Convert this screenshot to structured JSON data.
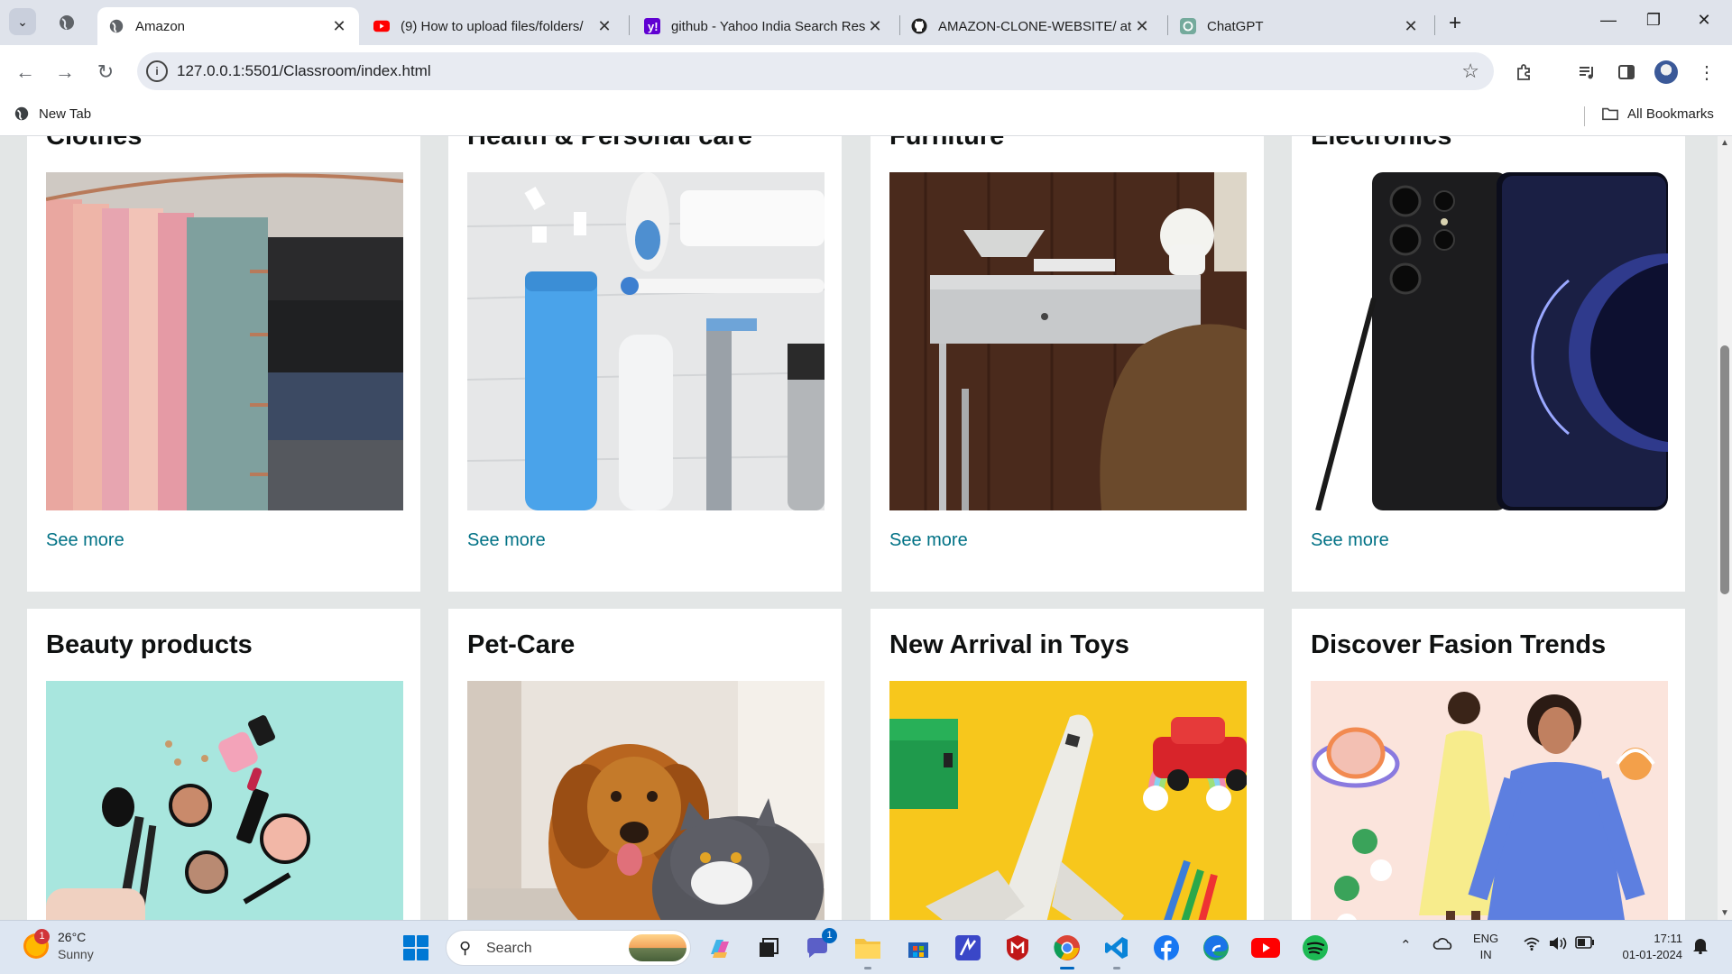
{
  "browser": {
    "tabs": [
      {
        "title": "Amazon",
        "active": true
      },
      {
        "title": "(9) How to upload files/folders/",
        "active": false
      },
      {
        "title": "github - Yahoo India Search Res",
        "active": false
      },
      {
        "title": "AMAZON-CLONE-WEBSITE/ at",
        "active": false
      },
      {
        "title": "ChatGPT",
        "active": false
      }
    ],
    "url": "127.0.0.1:5501/Classroom/index.html",
    "bookmarks": {
      "new_tab": "New Tab",
      "all": "All Bookmarks"
    }
  },
  "page": {
    "cards": [
      {
        "title": "Clothes",
        "link": "See more"
      },
      {
        "title": "Health & Personal care",
        "link": "See more"
      },
      {
        "title": "Furniture",
        "link": "See more"
      },
      {
        "title": "Electronics",
        "link": "See more"
      },
      {
        "title": "Beauty products",
        "link": ""
      },
      {
        "title": "Pet-Care",
        "link": ""
      },
      {
        "title": "New Arrival in Toys",
        "link": ""
      },
      {
        "title": "Discover Fasion Trends",
        "link": ""
      }
    ],
    "link_color": "#007185"
  },
  "taskbar": {
    "weather": {
      "temp": "26°C",
      "condition": "Sunny",
      "badge": "1"
    },
    "search_label": "Search",
    "teams_badge": "1",
    "lang": {
      "line1": "ENG",
      "line2": "IN"
    },
    "clock": {
      "time": "17:11",
      "date": "01-01-2024"
    }
  }
}
